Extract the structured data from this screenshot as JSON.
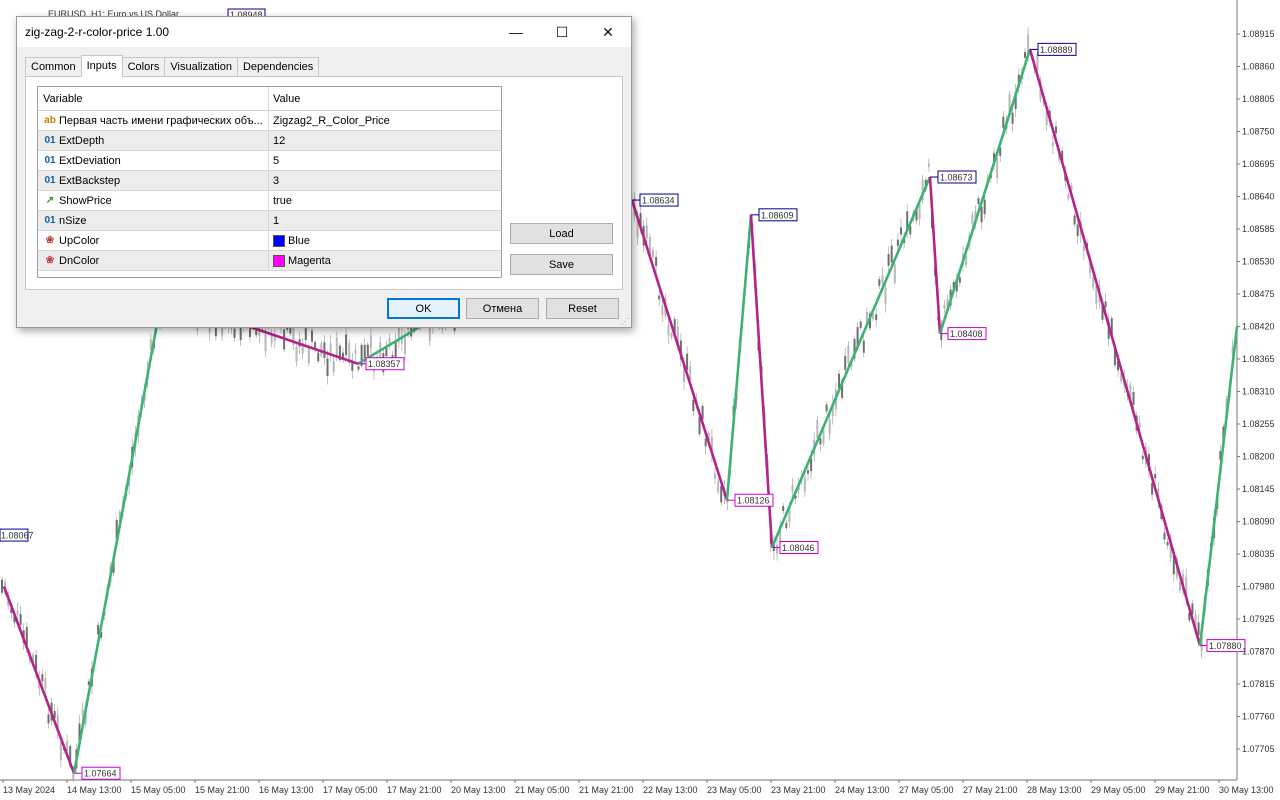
{
  "chart": {
    "window_title": "EURUSD, H1:  Euro vs US Dollar",
    "top_label": "1.08948",
    "colors": {
      "up": "#3cb371",
      "down": "#b5228c",
      "up_label": "#00008b",
      "down_label": "#cc00cc",
      "candle": "#9a9a9a"
    },
    "price_scale": [
      "1.08915",
      "1.08860",
      "1.08805",
      "1.08750",
      "1.08695",
      "1.08640",
      "1.08585",
      "1.08530",
      "1.08475",
      "1.08420",
      "1.08365",
      "1.08310",
      "1.08255",
      "1.08200",
      "1.08145",
      "1.08090",
      "1.08035",
      "1.07980",
      "1.07925",
      "1.07870",
      "1.07815",
      "1.07760",
      "1.07705"
    ],
    "time_scale": [
      "13 May 2024",
      "14 May 13:00",
      "15 May 05:00",
      "15 May 21:00",
      "16 May 13:00",
      "17 May 05:00",
      "17 May 21:00",
      "20 May 13:00",
      "21 May 05:00",
      "21 May 21:00",
      "22 May 13:00",
      "23 May 05:00",
      "23 May 21:00",
      "24 May 13:00",
      "27 May 05:00",
      "27 May 21:00",
      "28 May 13:00",
      "29 May 05:00",
      "29 May 21:00",
      "30 May 13:00"
    ],
    "zigzag": [
      {
        "price": 1.0798,
        "label": ""
      },
      {
        "price": 1.07664,
        "label": "1.07664"
      },
      {
        "price": 1.0847,
        "label": ""
      },
      {
        "price": 1.08357,
        "label": "1.08357"
      },
      {
        "price": 1.08634,
        "label": "1.08634"
      },
      {
        "price": 1.08126,
        "label": "1.08126"
      },
      {
        "price": 1.08609,
        "label": "1.08609"
      },
      {
        "price": 1.08046,
        "label": "1.08046"
      },
      {
        "price": 1.08673,
        "label": "1.08673"
      },
      {
        "price": 1.08408,
        "label": "1.08408"
      },
      {
        "price": 1.08889,
        "label": "1.08889"
      },
      {
        "price": 1.0788,
        "label": "1.07880"
      },
      {
        "price": 1.0842,
        "label": ""
      }
    ],
    "left_edge_label": "1.08067"
  },
  "dialog": {
    "title": "zig-zag-2-r-color-price 1.00",
    "tabs": [
      "Common",
      "Inputs",
      "Colors",
      "Visualization",
      "Dependencies"
    ],
    "active_tab": "Inputs",
    "columns": {
      "variable": "Variable",
      "value": "Value"
    },
    "rows": [
      {
        "icon": "ab",
        "icon_name": "string-icon",
        "variable": "Первая часть имени графических объ...",
        "value": "Zigzag2_R_Color_Price"
      },
      {
        "icon": "01",
        "icon_name": "int-icon",
        "variable": "ExtDepth",
        "value": "12"
      },
      {
        "icon": "01",
        "icon_name": "int-icon",
        "variable": "ExtDeviation",
        "value": "5"
      },
      {
        "icon": "01",
        "icon_name": "int-icon",
        "variable": "ExtBackstep",
        "value": "3"
      },
      {
        "icon": "↗",
        "icon_name": "bool-icon",
        "variable": "ShowPrice",
        "value": "true"
      },
      {
        "icon": "01",
        "icon_name": "int-icon",
        "variable": "nSize",
        "value": "1"
      },
      {
        "icon": "❀",
        "icon_name": "color-icon",
        "variable": "UpColor",
        "value": "Blue",
        "swatch": "#0000ff"
      },
      {
        "icon": "❀",
        "icon_name": "color-icon",
        "variable": "DnColor",
        "value": "Magenta",
        "swatch": "#ff00ff"
      }
    ],
    "buttons": {
      "load": "Load",
      "save": "Save",
      "ok": "OK",
      "cancel": "Отмена",
      "reset": "Reset"
    }
  }
}
